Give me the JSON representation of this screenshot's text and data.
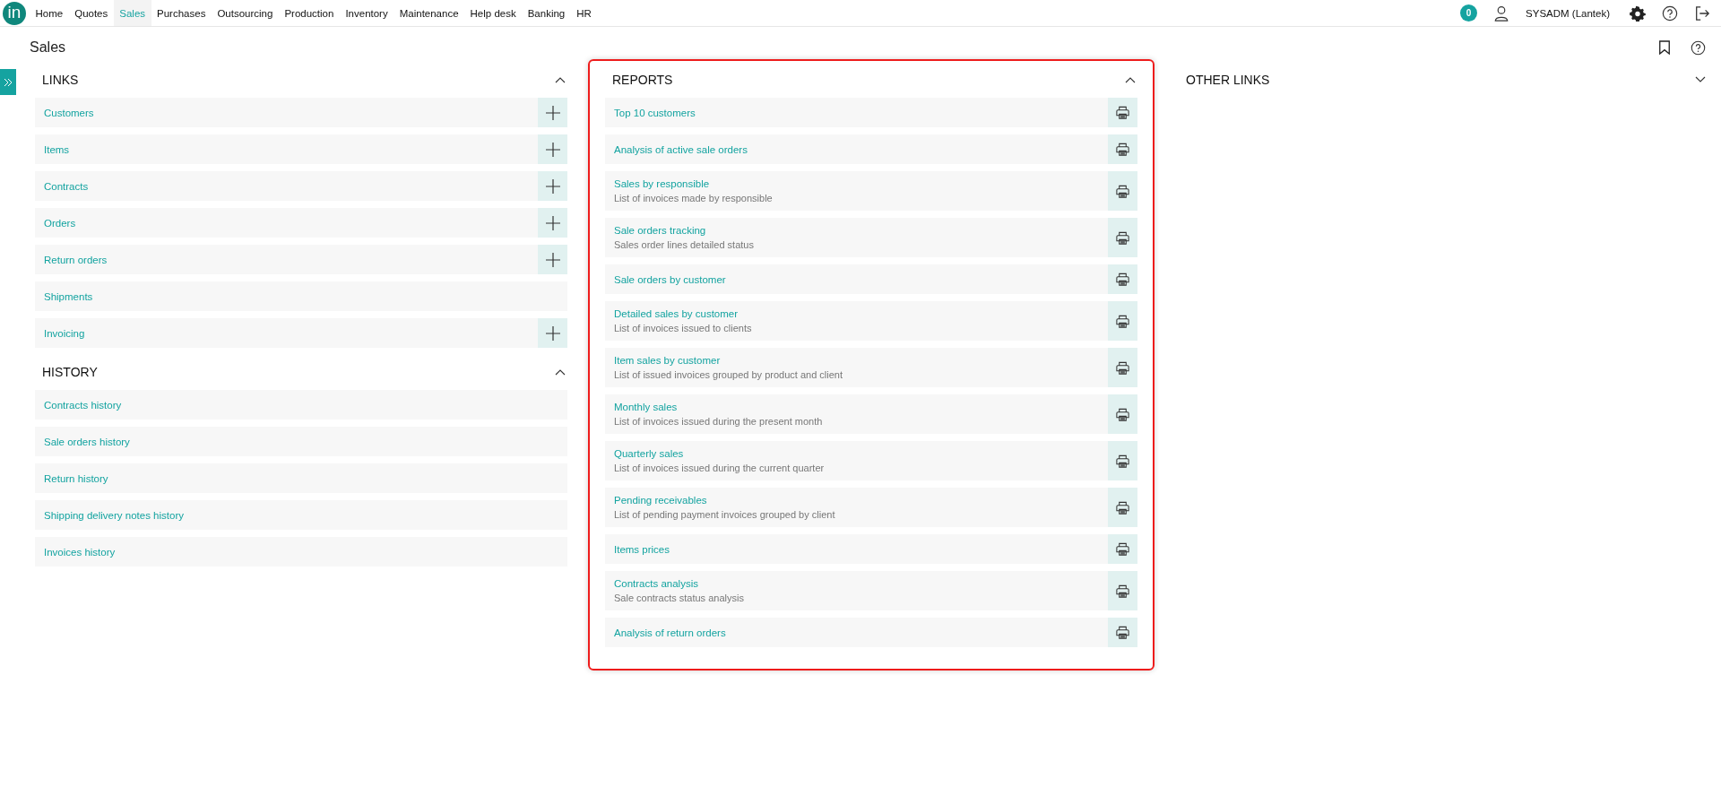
{
  "nav": {
    "logo": "in",
    "items": [
      {
        "label": "Home",
        "selected": false
      },
      {
        "label": "Quotes",
        "selected": false
      },
      {
        "label": "Sales",
        "selected": true
      },
      {
        "label": "Purchases",
        "selected": false
      },
      {
        "label": "Outsourcing",
        "selected": false
      },
      {
        "label": "Production",
        "selected": false
      },
      {
        "label": "Inventory",
        "selected": false
      },
      {
        "label": "Maintenance",
        "selected": false
      },
      {
        "label": "Help desk",
        "selected": false
      },
      {
        "label": "Banking",
        "selected": false
      },
      {
        "label": "HR",
        "selected": false
      }
    ],
    "notification_count": "0",
    "user": "SYSADM (Lantek)"
  },
  "page_title": "Sales",
  "sections": [
    {
      "title": "LINKS",
      "expanded": true,
      "items": [
        {
          "label": "Customers",
          "has_add": true
        },
        {
          "label": "Items",
          "has_add": true
        },
        {
          "label": "Contracts",
          "has_add": true
        },
        {
          "label": "Orders",
          "has_add": true
        },
        {
          "label": "Return orders",
          "has_add": true
        },
        {
          "label": "Shipments",
          "has_add": false
        },
        {
          "label": "Invoicing",
          "has_add": true
        }
      ]
    },
    {
      "title": "HISTORY",
      "expanded": true,
      "items": [
        {
          "label": "Contracts history",
          "has_add": false
        },
        {
          "label": "Sale orders history",
          "has_add": false
        },
        {
          "label": "Return history",
          "has_add": false
        },
        {
          "label": "Shipping delivery notes history",
          "has_add": false
        },
        {
          "label": "Invoices history",
          "has_add": false
        }
      ]
    },
    {
      "title": "REPORTS",
      "expanded": true,
      "highlighted": true,
      "items": [
        {
          "label": "Top 10 customers"
        },
        {
          "label": "Analysis of active sale orders"
        },
        {
          "label": "Sales by responsible",
          "description": "List of invoices made by responsible"
        },
        {
          "label": "Sale orders tracking",
          "description": "Sales order lines detailed status"
        },
        {
          "label": "Sale orders by customer"
        },
        {
          "label": "Detailed sales by customer",
          "description": "List of invoices issued to clients"
        },
        {
          "label": "Item sales by customer",
          "description": "List of issued invoices grouped by product and client"
        },
        {
          "label": "Monthly sales",
          "description": "List of invoices issued during the present month"
        },
        {
          "label": "Quarterly sales",
          "description": "List of invoices issued during the current quarter"
        },
        {
          "label": "Pending receivables",
          "description": "List of pending payment invoices grouped by client"
        },
        {
          "label": "Items prices"
        },
        {
          "label": "Contracts analysis",
          "description": "Sale contracts status analysis"
        },
        {
          "label": "Analysis of return orders"
        }
      ]
    },
    {
      "title": "OTHER LINKS",
      "expanded": false
    }
  ]
}
